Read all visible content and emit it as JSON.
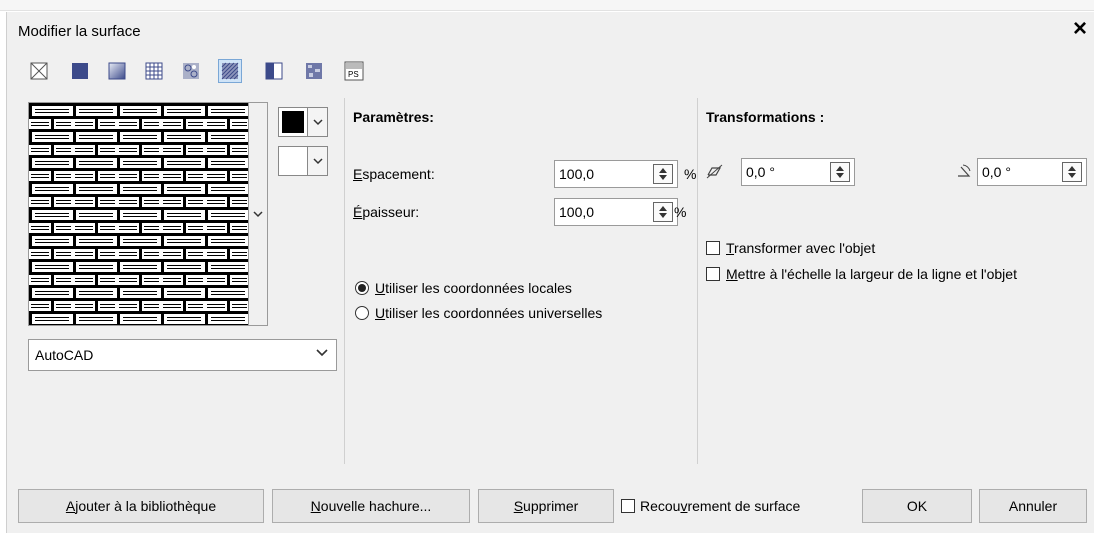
{
  "dialog": {
    "title": "Modifier la surface",
    "close_icon": "×"
  },
  "toolbar": {
    "icons": [
      "no-fill-icon",
      "uniform-fill-icon",
      "fountain-fill-icon",
      "vector-pattern-icon",
      "bitmap-pattern-icon",
      "hatch-fill-icon",
      "two-color-pattern-icon",
      "texture-fill-icon",
      "postscript-fill-icon"
    ],
    "ps_label": "PS"
  },
  "pattern": {
    "library_selected": "AutoCAD"
  },
  "parametres": {
    "title": "Paramètres:",
    "espacement": {
      "label_first": "E",
      "label_rest": "spacement:",
      "value": "100,0",
      "unit": "%"
    },
    "epaisseur": {
      "label_first": "É",
      "label_rest": "paisseur:",
      "value": "100,0",
      "unit": "%"
    },
    "radio_locales": {
      "first": "U",
      "rest": "tiliser les coordonnées locales",
      "checked": true
    },
    "radio_universelles": {
      "first": "U",
      "rest": "tiliser les coordonnées universelles",
      "checked": false
    }
  },
  "transformations": {
    "title": "Transformations :",
    "skew_value": "0,0 °",
    "rotate_value": "0,0 °",
    "cb_transformer": {
      "first": "T",
      "rest": "ransformer avec l'objet",
      "checked": false
    },
    "cb_echelle": {
      "first": "M",
      "rest": "ettre à l'échelle la largeur de la ligne et l'objet",
      "checked": false
    }
  },
  "footer": {
    "ajouter": {
      "first": "A",
      "rest": "jouter à la bibliothèque"
    },
    "nouvelle": {
      "first": "N",
      "rest": "ouvelle hachure..."
    },
    "supprimer": {
      "first": "S",
      "rest": "upprimer"
    },
    "recouvrement": {
      "pre": "Recou",
      "u": "v",
      "post": "rement de surface",
      "checked": false
    },
    "ok": "OK",
    "annuler": "Annuler"
  },
  "colors": {
    "foreground": "#000000",
    "background": "#ffffff",
    "accent": "#7aa7d6"
  }
}
